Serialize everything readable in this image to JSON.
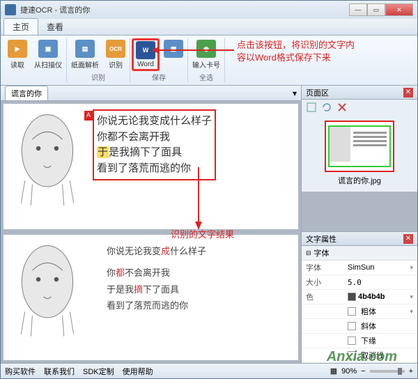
{
  "window": {
    "title": "捷速OCR - 谎言的你"
  },
  "tabs": {
    "home": "主页",
    "view": "查看"
  },
  "ribbon": {
    "read": "读取",
    "scanner": "从扫描仪",
    "analyze": "纸面解析",
    "recognize": "识别",
    "word": "Word",
    "card": "输入卡号",
    "group_recognize": "识别",
    "group_save": "保存",
    "group_select": "全选"
  },
  "annotations": {
    "word_tip_l1": "点击该按钮，将识别的文字内",
    "word_tip_l2": "容以Word格式保存下来",
    "result_label": "识别的文字结果"
  },
  "doc": {
    "tab": "谎言的你"
  },
  "ocr": {
    "l1": "你说无论我变成什么样子",
    "l2": "你都不会离开我",
    "l3a": "于",
    "l3b": "是我摘下了面具",
    "l4": "看到了落荒而逃的你"
  },
  "result": {
    "l1a": "你说无论我变",
    "l1b": "成",
    "l1c": "什么样子",
    "l2a": "你",
    "l2b": "都",
    "l2c": "不会离开我",
    "l3a": "于是我",
    "l3b": "摘",
    "l3c": "下了面具",
    "l4": "看到了落荒而逃的你"
  },
  "right": {
    "pages_title": "页面区",
    "thumb_label": "谎言的你.jpg",
    "props_title": "文字属性",
    "section": "字体",
    "font_k": "字体",
    "font_v": "SimSun",
    "size_k": "大小",
    "size_v": "5.0",
    "color_k": "色",
    "color_v": "4b4b4b",
    "bold": "粗体",
    "italic": "斜体",
    "underline": "下缘",
    "strike": "取消线"
  },
  "status": {
    "buy": "购买软件",
    "contact": "联系我们",
    "sdk": "SDK定制",
    "help": "使用帮助",
    "zoom": "90%"
  },
  "watermark": "Anxia.com"
}
